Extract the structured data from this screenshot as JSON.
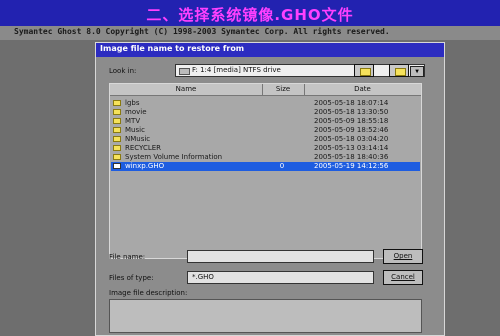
{
  "banner": {
    "title": "二、选择系统镜像.GHO文件",
    "color": "#ff40ff"
  },
  "app_bar": {
    "text": "Symantec Ghost 8.0   Copyright (C) 1998-2003 Symantec Corp. All rights reserved."
  },
  "dialog": {
    "title": "Image file name to restore from",
    "look_in_label": "Look in:",
    "look_in_value": "F: 1:4 [media] NTFS drive",
    "columns": {
      "name": "Name",
      "size": "Size",
      "date": "Date"
    },
    "files": [
      {
        "name": "lgbs",
        "size": "",
        "date": "2005-05-18 18:07:14",
        "icon": "folder-icon"
      },
      {
        "name": "movie",
        "size": "",
        "date": "2005-05-18 13:30:50",
        "icon": "folder-icon"
      },
      {
        "name": "MTV",
        "size": "",
        "date": "2005-05-09 18:55:18",
        "icon": "folder-icon"
      },
      {
        "name": "Music",
        "size": "",
        "date": "2005-05-09 18:52:46",
        "icon": "folder-icon"
      },
      {
        "name": "NMusic",
        "size": "",
        "date": "2005-05-18 03:04:20",
        "icon": "folder-icon"
      },
      {
        "name": "RECYCLER",
        "size": "",
        "date": "2005-05-13 03:14:14",
        "icon": "folder-icon"
      },
      {
        "name": "System Volume Information",
        "size": "",
        "date": "2005-05-18 18:40:36",
        "icon": "folder-icon"
      },
      {
        "name": "winxp.GHO",
        "size": "0",
        "date": "2005-05-19 14:12:56",
        "icon": "file-icon",
        "selected": true
      }
    ],
    "file_name_label": "File name:",
    "file_name_value": "",
    "files_of_type_label": "Files of type:",
    "files_of_type_value": "*.GHO",
    "open_button": "Open",
    "cancel_button": "Cancel",
    "description_label": "Image file description:"
  }
}
